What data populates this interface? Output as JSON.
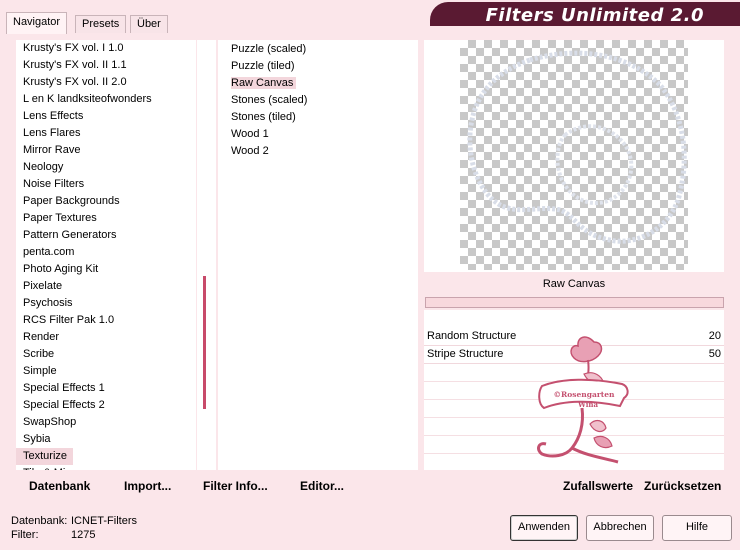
{
  "tabs": [
    {
      "label": "Navigator",
      "active": true
    },
    {
      "label": "Presets",
      "active": false
    },
    {
      "label": "Über",
      "active": false
    }
  ],
  "title": "Filters Unlimited 2.0",
  "categories": [
    "Krusty's FX vol. I 1.0",
    "Krusty's FX vol. II 1.1",
    "Krusty's FX vol. II 2.0",
    "L en K landksiteofwonders",
    "Lens Effects",
    "Lens Flares",
    "Mirror Rave",
    "Neology",
    "Noise Filters",
    "Paper Backgrounds",
    "Paper Textures",
    "Pattern Generators",
    "penta.com",
    "Photo Aging Kit",
    "Pixelate",
    "Psychosis",
    "RCS Filter Pak 1.0",
    "Render",
    "Scribe",
    "Simple",
    "Special Effects 1",
    "Special Effects 2",
    "SwapShop",
    "Sybia",
    "Texturize",
    "Tile & Mirror"
  ],
  "selected_category": "Texturize",
  "filters": [
    "Puzzle (scaled)",
    "Puzzle (tiled)",
    "Raw Canvas",
    "Stones (scaled)",
    "Stones (tiled)",
    "Wood 1",
    "Wood 2"
  ],
  "selected_filter": "Raw Canvas",
  "preview": {
    "filter_name": "Raw Canvas"
  },
  "params": [
    {
      "label": "Random Structure",
      "value": "20"
    },
    {
      "label": "Stripe Structure",
      "value": "50"
    }
  ],
  "watermark": {
    "line1": "©Rosengarten",
    "line2": "Wina"
  },
  "toolbar": {
    "database": "Datenbank",
    "import": "Import...",
    "filter_info": "Filter Info...",
    "editor": "Editor...",
    "random": "Zufallswerte",
    "reset": "Zurücksetzen"
  },
  "status": {
    "database_label": "Datenbank:",
    "database_value": "ICNET-Filters",
    "filter_label": "Filter:",
    "filter_value": "1275"
  },
  "buttons": {
    "apply": "Anwenden",
    "cancel": "Abbrechen",
    "help": "Hilfe"
  },
  "colors": {
    "background": "#fbe6ea",
    "title_bar": "#5a1a32",
    "accent": "#c84a6a",
    "selection": "#f3d6dc"
  }
}
